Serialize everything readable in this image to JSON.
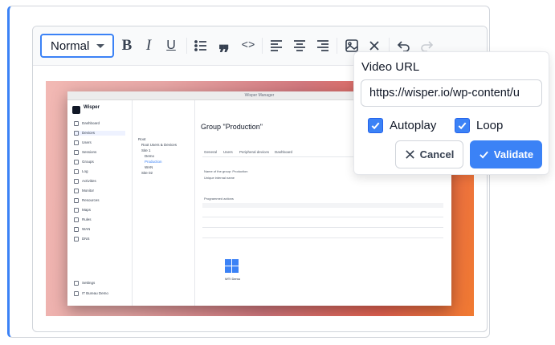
{
  "toolbar": {
    "style_select": "Normal",
    "icons": [
      "bold-icon",
      "italic-icon",
      "underline-icon",
      "bullet-list-icon",
      "blockquote-icon",
      "code-icon",
      "align-left-icon",
      "align-center-icon",
      "align-right-icon",
      "image-icon",
      "clear-format-icon",
      "undo-icon",
      "redo-icon"
    ],
    "bold": "B",
    "italic": "I",
    "underline": "U",
    "quote": "❞",
    "code": "<>"
  },
  "video_popup": {
    "label": "Video URL",
    "url_value": "https://wisper.io/wp-content/u",
    "autoplay_label": "Autoplay",
    "autoplay_checked": true,
    "loop_label": "Loop",
    "loop_checked": true,
    "cancel_label": "Cancel",
    "validate_label": "Validate"
  },
  "embedded_screenshot": {
    "window_title": "Wisper Manager",
    "brand": "Wisper",
    "sidebar_items": [
      "Dashboard",
      "Devices",
      "Users",
      "Sessions",
      "Groups",
      "Log",
      "Activities",
      "Monitor",
      "Resources",
      "Maps",
      "Rules",
      "WAN",
      "DNS"
    ],
    "bottom_items": [
      "Settings",
      "IT Bureau Demo"
    ],
    "page_title": "Group \"Production\"",
    "tabs": [
      "General",
      "Users",
      "Peripheral devices",
      "Dashboard"
    ],
    "tree": [
      "Root",
      "Root Users & Devices",
      "Site 1",
      "Demo",
      "Production",
      "WAN",
      "Site 02"
    ],
    "rows": [
      "Name of the group: Production",
      "Unique internal name",
      "Programmed actions"
    ],
    "device_label": "WTI Demo"
  },
  "colors": {
    "accent": "#3b82f6",
    "border": "#d1d5db"
  }
}
